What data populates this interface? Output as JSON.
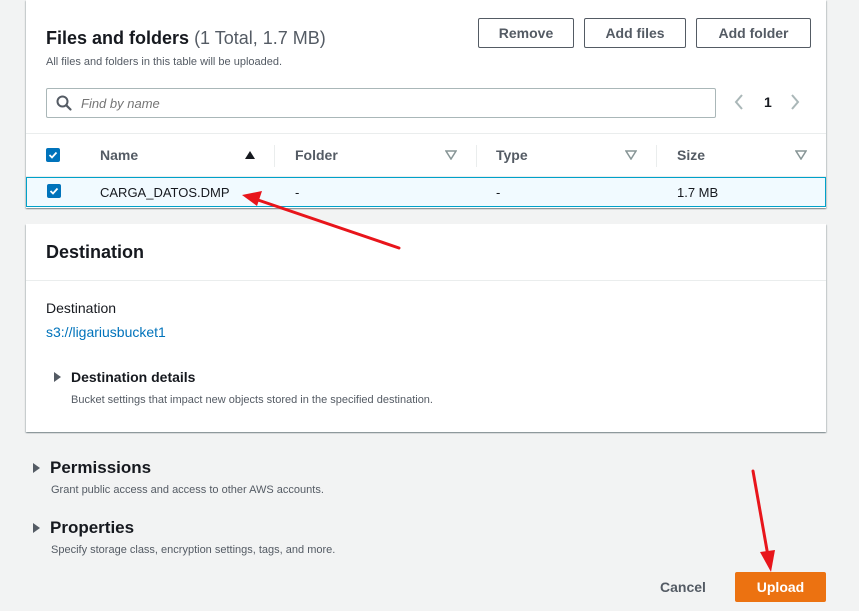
{
  "files": {
    "title": "Files and folders",
    "count": "(1 Total, 1.7 MB)",
    "subtitle": "All files and folders in this table will be uploaded.",
    "buttons": {
      "remove": "Remove",
      "add_files": "Add files",
      "add_folder": "Add folder"
    },
    "search": {
      "placeholder": "Find by name",
      "icon": "search-icon"
    },
    "pagination": {
      "page": "1"
    },
    "columns": {
      "name": "Name",
      "folder": "Folder",
      "type": "Type",
      "size": "Size"
    },
    "rows": [
      {
        "name": "CARGA_DATOS.DMP",
        "folder": "-",
        "type": "-",
        "size": "1.7 MB",
        "selected": true
      }
    ]
  },
  "destination": {
    "title": "Destination",
    "label": "Destination",
    "link": "s3://ligariusbucket1",
    "details": {
      "title": "Destination details",
      "desc": "Bucket settings that impact new objects stored in the specified destination."
    }
  },
  "permissions": {
    "title": "Permissions",
    "desc": "Grant public access and access to other AWS accounts."
  },
  "properties": {
    "title": "Properties",
    "desc": "Specify storage class, encryption settings, tags, and more."
  },
  "footer": {
    "cancel": "Cancel",
    "upload": "Upload"
  },
  "colors": {
    "accent": "#0073bb",
    "upload": "#ec7211",
    "annotation": "#e8151b"
  }
}
